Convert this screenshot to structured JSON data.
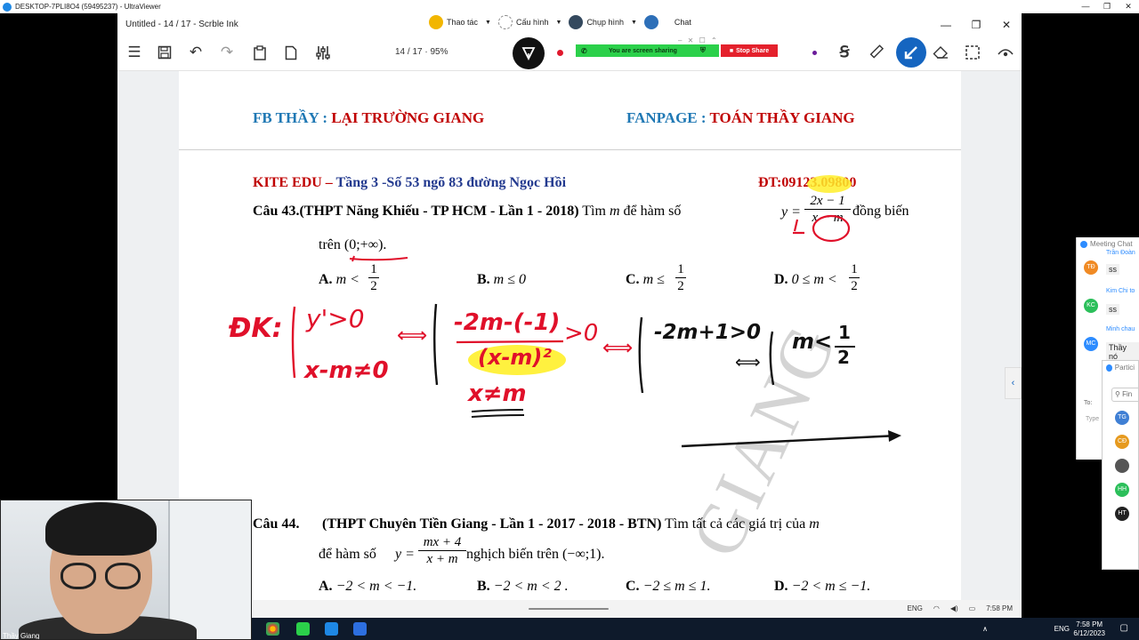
{
  "outer": {
    "title": "DESKTOP-7PLI8O4 (59495237) - UltraViewer",
    "minimize": "—",
    "restore": "❐",
    "close": "✕"
  },
  "window": {
    "title": "Untitled - 14 / 17 - Scrble Ink",
    "minimize": "—",
    "restore": "❐",
    "close": "✕"
  },
  "zoom": {
    "thao_tac": "Thao tác",
    "cau_hinh": "Cấu hình",
    "chup_hinh": "Chụp hình",
    "chat": "Chat"
  },
  "toolbar": {
    "page_indicator": "14 / 17  ·  95%",
    "screen_sharing": "You are screen sharing",
    "stop_share": "Stop Share",
    "window_ctrls": "– ⨯ ☐ ⌃"
  },
  "document": {
    "fb_label": "FB THẦY : ",
    "fb_name": "LẠI TRƯỜNG GIANG",
    "fanpage_label": "FANPAGE : ",
    "fanpage_name": "TOÁN THẦY GIANG",
    "kite_red": "KITE EDU – ",
    "kite_address": "Tầng 3 -Số 53 ngõ 83 đường Ngọc Hồi",
    "phone": "ĐT:09123.09800",
    "q43_head": "Câu 43.(THPT Năng Khiếu - TP HCM - Lần 1 - 2018)",
    "q43_text1": " Tìm ",
    "q43_m": "m",
    "q43_text2": " để hàm số ",
    "q43_y": "y =",
    "q43_num": "2x − 1",
    "q43_den": "x − m",
    "q43_text3": "đồng biến",
    "q43_line2a": "trên ",
    "q43_interval": "(0;+∞)",
    "q43_line2b": ".",
    "optA_label": "A.",
    "optA_expr": "m <",
    "optA_num": "1",
    "optA_den": "2",
    "optB_label": "B.",
    "optB_expr": "m ≤ 0",
    "optC_label": "C.",
    "optC_expr": "m ≤",
    "optC_num": "1",
    "optC_den": "2",
    "optD_label": "D.",
    "optD_expr": "0 ≤ m <",
    "optD_num": "1",
    "optD_den": "2",
    "q44_head": "Câu 44.",
    "q44_source": "(THPT Chuyên Tiền Giang - Lần 1 - 2017 - 2018 - BTN)",
    "q44_text1": " Tìm tất cả các giá trị của ",
    "q44_m": "m",
    "q44_line2a": "để hàm số ",
    "q44_y": "y =",
    "q44_num": "mx + 4",
    "q44_den": "x + m",
    "q44_line2b": " nghịch biến trên ",
    "q44_interval": "(−∞;1).",
    "q44A": "−2 < m < −1.",
    "q44B": "−2 < m < 2 .",
    "q44C": "−2 ≤ m ≤ 1.",
    "q44D": "−2 < m ≤ −1.",
    "watermark": "GIANG"
  },
  "handwriting": {
    "dk": "ĐK:",
    "y_prime": "y'>0",
    "x_ne_m": "x-m≠0",
    "equiv1": "⟺",
    "numerator": "-2m-(-1)",
    "gt0": ">0",
    "denominator": "(x-m)²",
    "x_ne_m2": "x≠m",
    "equiv2": "⟺",
    "ineq": "-2m+1>0",
    "equiv3": "⟺",
    "m_lt": "m<",
    "half_num": "1",
    "half_den": "2"
  },
  "win_taskbar": {
    "eng": "ENG",
    "time": "7:58 PM"
  },
  "chat": {
    "title": "Meeting Chat",
    "msg1_name": "Trần Đoàn",
    "msg1_text": "ss",
    "msg1_avatar": "TĐ",
    "msg2_name": "Kim Chi to",
    "msg2_text": "ss",
    "msg2_avatar": "KC",
    "msg3_name": "Minh chau",
    "msg3_text": "Thầy nó",
    "msg3_avatar": "MC",
    "to_label": "To:",
    "type_label": "Type"
  },
  "participants": {
    "title": "Partici",
    "search": "Fin",
    "list": [
      "TG",
      "CĐ",
      "",
      "HH",
      "HT"
    ]
  },
  "cam": {
    "name": "Thầy Giang"
  },
  "local_taskbar": {
    "eng": "ENG",
    "time": "7:58 PM",
    "date": "6/12/2023"
  },
  "colors": {
    "accent_blue": "#1f78b4",
    "accent_red": "#c00000",
    "ink_red": "#e0102a",
    "highlight": "#ffef2a",
    "share_green": "#2bd04a"
  }
}
